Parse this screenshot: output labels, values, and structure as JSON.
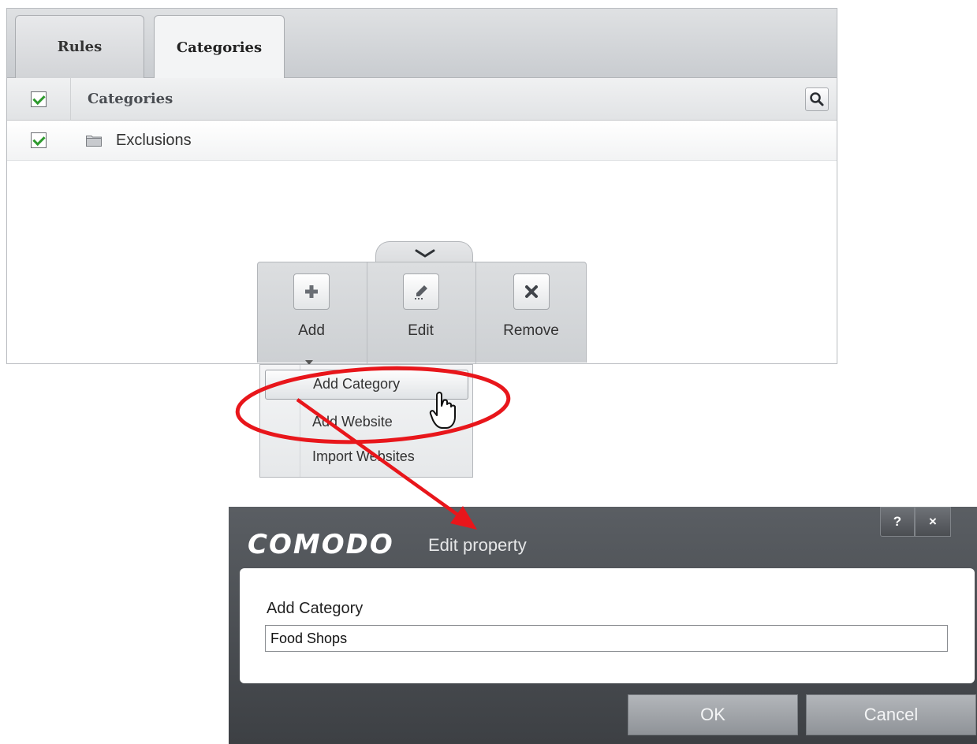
{
  "tabs": [
    {
      "label": "Rules",
      "active": false
    },
    {
      "label": "Categories",
      "active": true
    }
  ],
  "table": {
    "header": {
      "label": "Categories",
      "checked": true
    },
    "rows": [
      {
        "label": "Exclusions",
        "checked": true,
        "icon": "folder-icon"
      }
    ]
  },
  "toolbar": {
    "add_label": "Add",
    "edit_label": "Edit",
    "remove_label": "Remove",
    "icons": {
      "add": "plus-icon",
      "edit": "pencil-icon",
      "remove": "x-icon",
      "collapse": "chevron-down-icon"
    }
  },
  "add_menu": {
    "items": [
      "Add Category",
      "Add Website",
      "Import Websites"
    ],
    "highlighted": "Add Category"
  },
  "dialog": {
    "brand": "COMODO",
    "title": "Edit property",
    "help_label": "?",
    "close_label": "×",
    "field_label": "Add Category",
    "field_value": "Food Shops",
    "ok_label": "OK",
    "cancel_label": "Cancel"
  },
  "colors": {
    "annotation": "#e8161b",
    "checkmark": "#2e9a2e",
    "dialog_bg": "#45494e"
  }
}
